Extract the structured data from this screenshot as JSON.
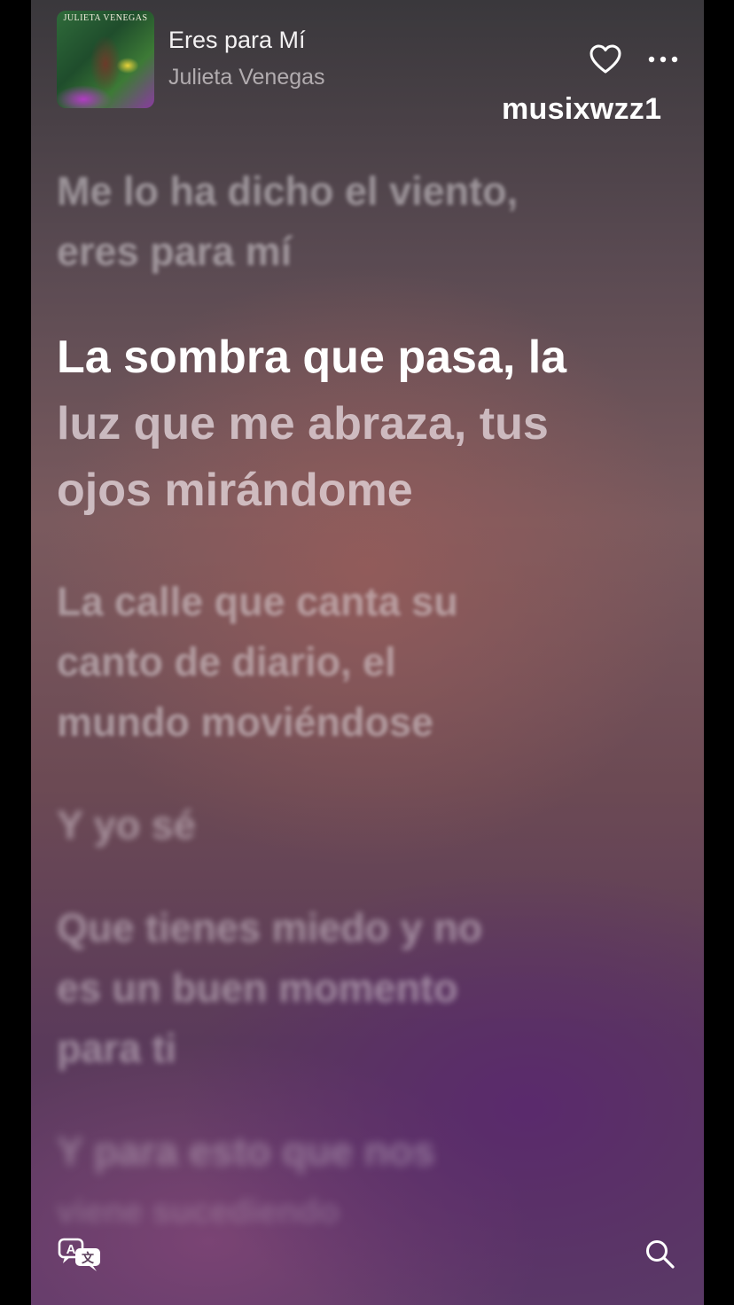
{
  "now_playing": {
    "album_art_text": "JULIETA VENEGAS",
    "title": "Eres para Mí",
    "artist": "Julieta Venegas"
  },
  "watermark": "musixwzz1",
  "icons": {
    "favorite": "heart-icon",
    "more": "more-options-icon",
    "translate": "translate-icon",
    "search": "search-icon"
  },
  "lyrics": {
    "previous": [
      "Me lo ha dicho el viento,",
      "eres para mí"
    ],
    "current": {
      "sung": "La sombra que pasa, la",
      "unsung_lines": [
        "luz que me abraza, tus",
        "ojos mirándome"
      ]
    },
    "upcoming": [
      [
        "La calle que canta su",
        "canto de diario, el",
        "mundo moviéndose"
      ],
      [
        "Y yo sé"
      ],
      [
        "Que tienes miedo y no",
        "es un buen momento",
        "para ti"
      ],
      [
        "Y para esto que nos",
        "viene sucediendo"
      ]
    ]
  }
}
